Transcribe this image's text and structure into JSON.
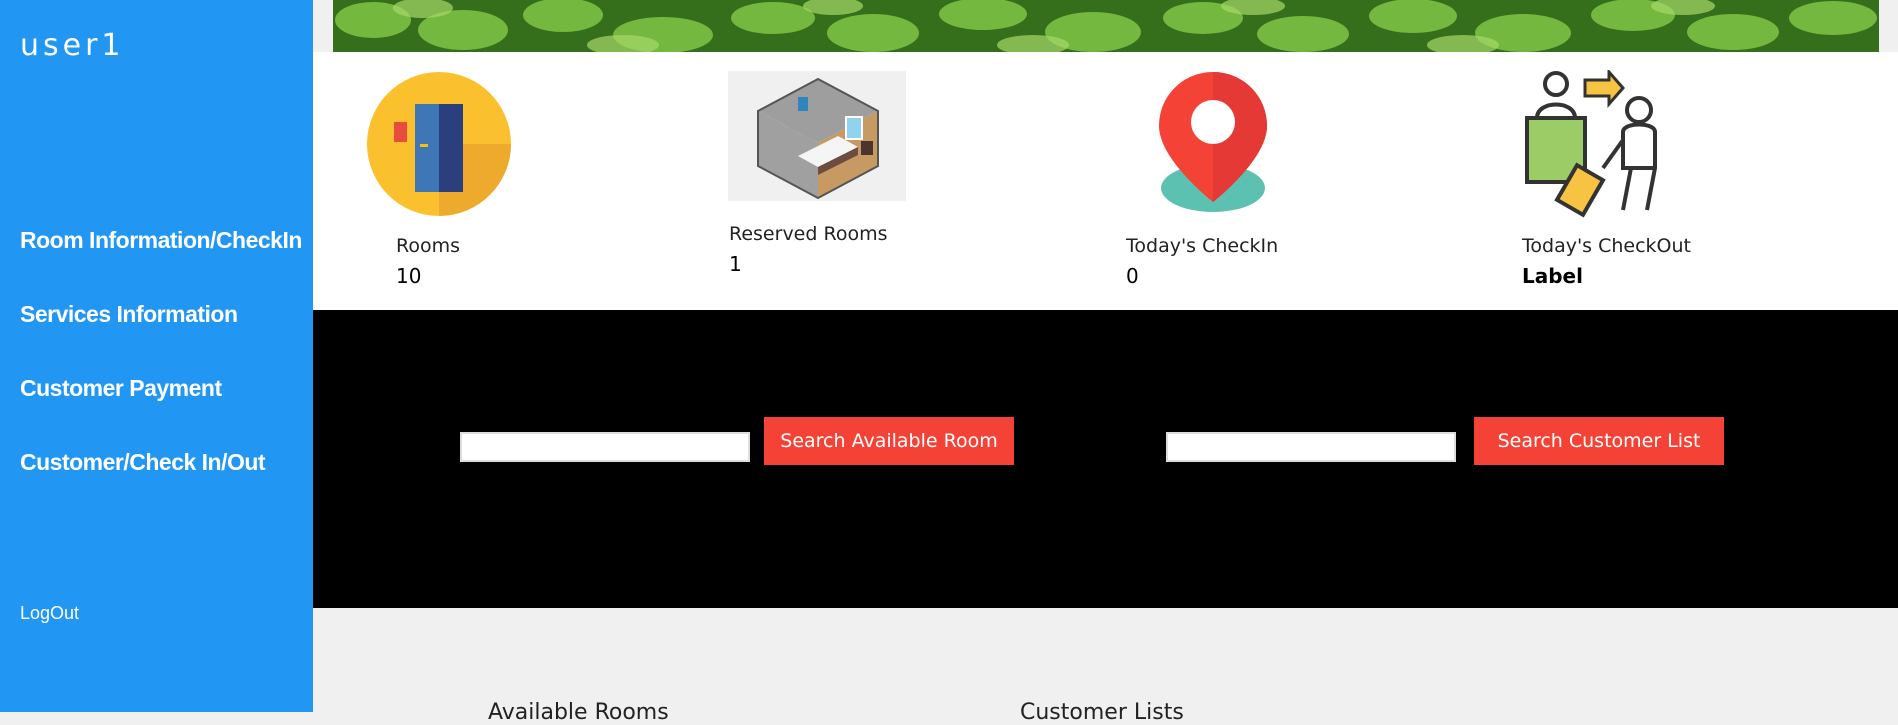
{
  "sidebar": {
    "username": "user1",
    "nav": [
      {
        "label": "Room Information/CheckIn"
      },
      {
        "label": "Services Information"
      },
      {
        "label": "Customer Payment"
      },
      {
        "label": "Customer/Check In/Out"
      }
    ],
    "logout_label": "LogOut",
    "color": "#2196f3"
  },
  "stats": [
    {
      "label": "Rooms",
      "value": "10",
      "icon": "door-icon"
    },
    {
      "label": "Reserved Rooms",
      "value": "1",
      "icon": "bedroom-icon"
    },
    {
      "label": "Today's CheckIn",
      "value": "0",
      "icon": "location-pin-icon"
    },
    {
      "label": "Today's CheckOut",
      "value": "Label",
      "icon": "checkout-traveler-icon"
    }
  ],
  "search": {
    "room_button": "Search Available Room",
    "customer_button": "Search Customer List",
    "room_input_value": "",
    "customer_input_value": "",
    "button_color": "#f44336"
  },
  "bottom": {
    "available_label": "Available Rooms",
    "customer_label": "Customer Lists"
  }
}
